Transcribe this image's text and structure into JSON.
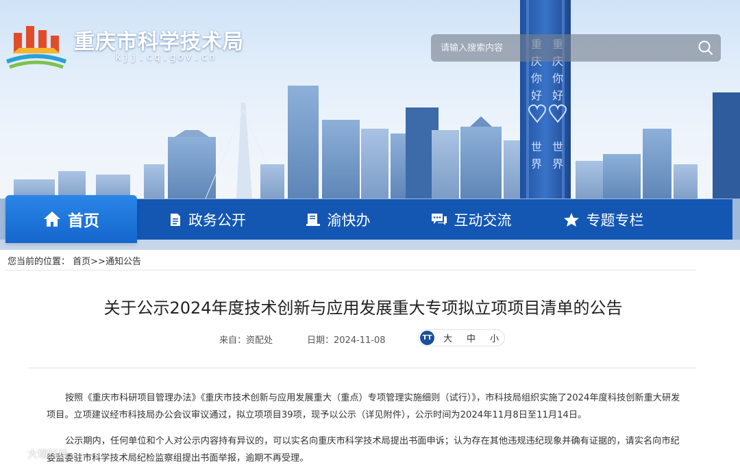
{
  "header": {
    "site_title": "重庆市科学技术局",
    "site_domain": "kjj.cq.gov.cn",
    "search_placeholder": "请输入搜索内容",
    "tower_text": "重庆你好 世界你好"
  },
  "nav": {
    "items": [
      {
        "label": "首页",
        "icon": "home-icon",
        "active": true
      },
      {
        "label": "政务公开",
        "icon": "document-icon"
      },
      {
        "label": "渝快办",
        "icon": "book-icon"
      },
      {
        "label": "互动交流",
        "icon": "chat-icon"
      },
      {
        "label": "专题专栏",
        "icon": "star-icon"
      }
    ]
  },
  "breadcrumb": {
    "prefix": "您当前的位置：",
    "path": "首页>>通知公告"
  },
  "article": {
    "title": "关于公示2024年度技术创新与应用发展重大专项拟立项项目清单的公告",
    "source": "来自：资配处",
    "date": "日期：2024-11-08",
    "font_sizes": [
      "大",
      "中",
      "小"
    ],
    "font_icon": "TT",
    "paragraph1": "按照《重庆市科研项目管理办法》《重庆市技术创新与应用发展重大（重点）专项管理实施细则（试行）》，市科技局组织实施了2024年度科技创新重大研发项目。立项建议经市科技局办公会议审议通过，拟立项项目39项，现予以公示（详见附件），公示时间为2024年11月8日至11月14日。",
    "paragraph2": "公示期内，任何单位和个人对公示内容持有异议的，可以实名向重庆市科学技术局提出书面申诉；认为存在其他违规违纪现象并确有证据的，请实名向市纪委监委驻市科学技术局纪检监察组提出书面举报，逾期不再受理。"
  },
  "watermark": {
    "text": "大瑞科技"
  },
  "colors": {
    "nav_bg": "#1357b3",
    "nav_active": "#1f77dc",
    "title_text": "#222222"
  }
}
